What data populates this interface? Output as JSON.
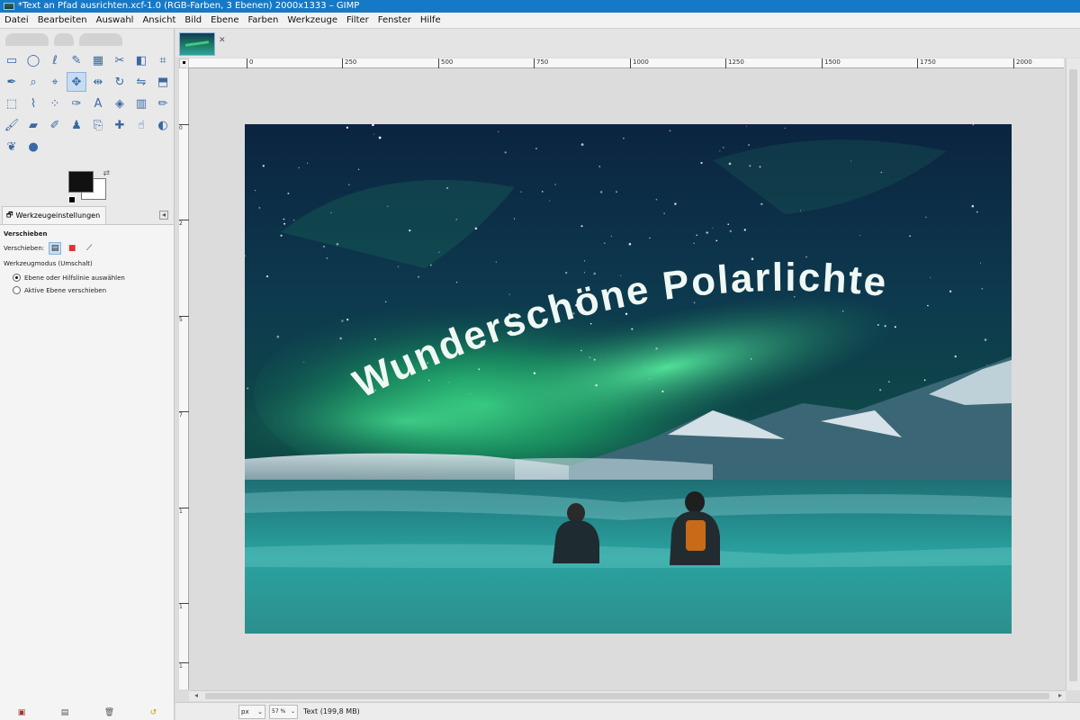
{
  "window": {
    "title": "*Text an Pfad ausrichten.xcf-1.0 (RGB-Farben, 3 Ebenen) 2000x1333 – GIMP"
  },
  "menu": [
    "Datei",
    "Bearbeiten",
    "Auswahl",
    "Ansicht",
    "Bild",
    "Ebene",
    "Farben",
    "Werkzeuge",
    "Filter",
    "Fenster",
    "Hilfe"
  ],
  "tools": [
    "rect-select-icon",
    "ellipse-select-icon",
    "free-select-icon",
    "fuzzy-select-icon",
    "select-by-color-icon",
    "scissors-icon",
    "foreground-select-icon",
    "crop-icon",
    "color-picker-icon",
    "zoom-icon",
    "measure-icon",
    "move-icon",
    "align-icon",
    "transform-icon",
    "flip-icon",
    "perspective-icon",
    "unified-transform-icon",
    "warp-icon",
    "handle-transform-icon",
    "paths-icon",
    "text-icon",
    "bucket-fill-icon",
    "blend-icon",
    "pencil-icon",
    "paintbrush-icon",
    "eraser-icon",
    "airbrush-icon",
    "ink-icon",
    "clone-icon",
    "heal-icon",
    "smudge-icon",
    "dodge-burn-icon",
    "mypaint-brush-icon",
    "gegl-icon"
  ],
  "tool_options": {
    "tab_label": "Werkzeugeinstellungen",
    "heading": "Verschieben",
    "move_label": "Verschieben:",
    "mode_label": "Werkzeugmodus (Umschalt)",
    "radio_1": "Ebene oder Hilfslinie auswählen",
    "radio_2": "Aktive Ebene verschieben"
  },
  "ruler": {
    "h_ticks": [
      "0",
      "250",
      "500",
      "750",
      "1000",
      "1250",
      "1500",
      "1750",
      "2000"
    ],
    "v_ticks": [
      "0",
      "2",
      "5",
      "7",
      "1",
      "1",
      "1"
    ]
  },
  "canvas": {
    "curved_text": "Wunderschöne Polarlichter"
  },
  "status": {
    "unit": "px",
    "zoom": "57 %",
    "text": "Text (199,8 MB)"
  },
  "colors": {
    "foreground": "#111111",
    "background": "#ffffff",
    "aurora": "#3ee88c",
    "text_fill": "#f0f8f4"
  }
}
